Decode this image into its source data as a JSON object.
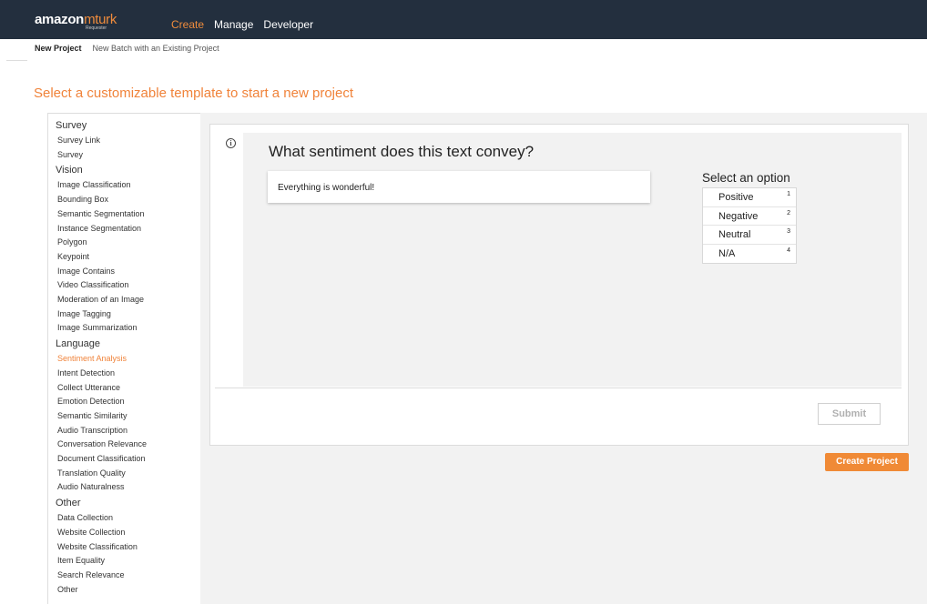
{
  "brand": {
    "name_bold": "amazon",
    "name_light": "mturk",
    "sub": "Requester"
  },
  "topnav": {
    "items": [
      "Create",
      "Manage",
      "Developer"
    ],
    "active": "Create"
  },
  "subnav": {
    "items": [
      "New Project",
      "New Batch with an Existing Project"
    ]
  },
  "heading": "Select a customizable template to start a new project",
  "templates": {
    "groups": [
      {
        "name": "Survey",
        "items": [
          "Survey Link",
          "Survey"
        ]
      },
      {
        "name": "Vision",
        "items": [
          "Image Classification",
          "Bounding Box",
          "Semantic Segmentation",
          "Instance Segmentation",
          "Polygon",
          "Keypoint",
          "Image Contains",
          "Video Classification",
          "Moderation of an Image",
          "Image Tagging",
          "Image Summarization"
        ]
      },
      {
        "name": "Language",
        "items": [
          "Sentiment Analysis",
          "Intent Detection",
          "Collect Utterance",
          "Emotion Detection",
          "Semantic Similarity",
          "Audio Transcription",
          "Conversation Relevance",
          "Document Classification",
          "Translation Quality",
          "Audio Naturalness"
        ]
      },
      {
        "name": "Other",
        "items": [
          "Data Collection",
          "Website Collection",
          "Website Classification",
          "Item Equality",
          "Search Relevance",
          "Other"
        ]
      }
    ],
    "selected": "Sentiment Analysis"
  },
  "preview": {
    "info_icon": "info-icon",
    "question": "What sentiment does this text convey?",
    "text": "Everything is wonderful!",
    "options_title": "Select an option",
    "options": [
      {
        "label": "Positive",
        "key": "1"
      },
      {
        "label": "Negative",
        "key": "2"
      },
      {
        "label": "Neutral",
        "key": "3"
      },
      {
        "label": "N/A",
        "key": "4"
      }
    ],
    "submit_label": "Submit"
  },
  "create_label": "Create Project",
  "colors": {
    "accent": "#f0833a",
    "nav_bg": "#232f3e"
  }
}
